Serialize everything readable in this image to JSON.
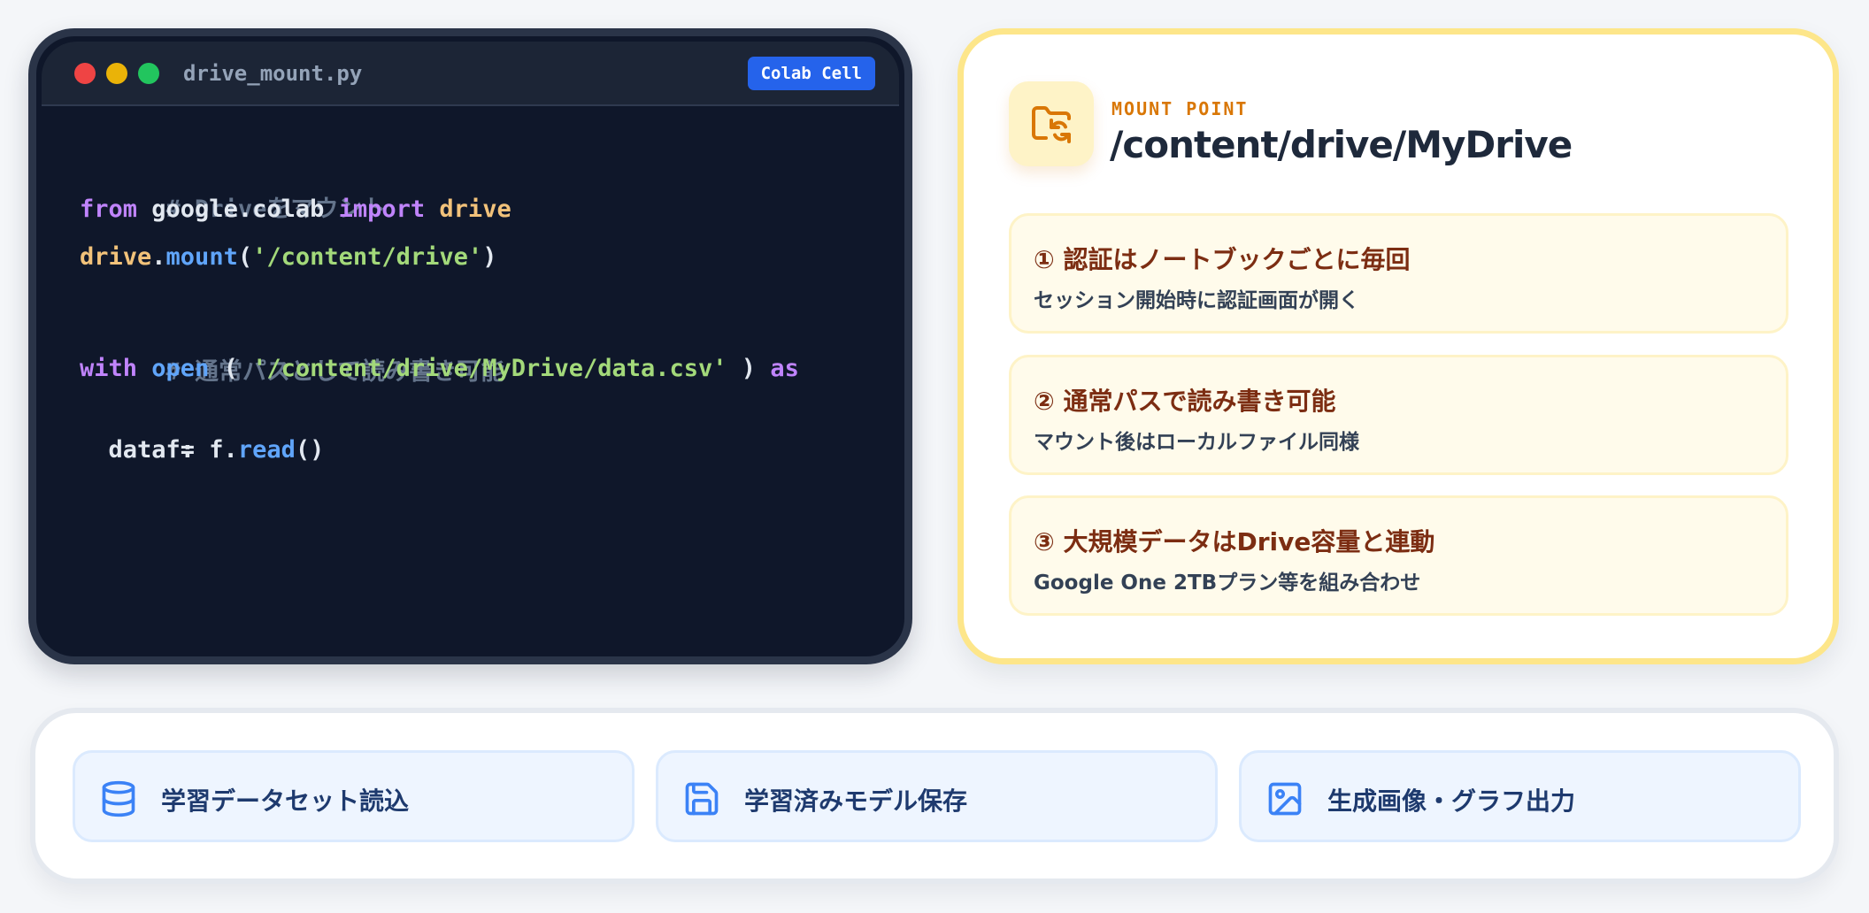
{
  "code_window": {
    "filename": "drive_mount.py",
    "badge": "Colab Cell",
    "lines": {
      "l1": "# Driveをマウント",
      "l2_from": "from",
      "l2_mod": " google.colab ",
      "l2_import": "import",
      "l2_sp": " ",
      "l2_name": "drive",
      "l3_var": "drive",
      "l3_dot": ".",
      "l3_fn": "mount",
      "l3_open": "(",
      "l3_str": "'/content/drive'",
      "l3_close": ")",
      "l4": "# 通常パスとして読み書き可能",
      "l5_with": "with",
      "l5_sp1": " ",
      "l5_open": "open",
      "l5_paren1": " ( ",
      "l5_str": "'/content/drive/MyDrive/data.csv'",
      "l5_paren2": " ) ",
      "l5_as": "as",
      "l6": "f:",
      "l7_a": "  data = f.",
      "l7_fn": "read",
      "l7_b": "()"
    }
  },
  "mount": {
    "label": "MOUNT POINT",
    "path": "/content/drive/MyDrive",
    "icon": "folder-sync-icon",
    "notes": [
      {
        "title": "① 認証はノートブックごとに毎回",
        "sub": "セッション開始時に認証画面が開く"
      },
      {
        "title": "② 通常パスで読み書き可能",
        "sub": "マウント後はローカルファイル同様"
      },
      {
        "title": "③ 大規模データはDrive容量と連動",
        "sub": "Google One 2TBプラン等を組み合わせ"
      }
    ]
  },
  "usage": [
    {
      "icon": "database-icon",
      "label": "学習データセット読込"
    },
    {
      "icon": "save-icon",
      "label": "学習済みモデル保存"
    },
    {
      "icon": "image-icon",
      "label": "生成画像・グラフ出力"
    }
  ],
  "colors": {
    "code_bg": "#0f172a",
    "badge": "#2563eb",
    "accent_amber": "#d97706",
    "note_title": "#7c2d12",
    "usage_text": "#1e3a6e",
    "usage_icon": "#3b82f6"
  }
}
